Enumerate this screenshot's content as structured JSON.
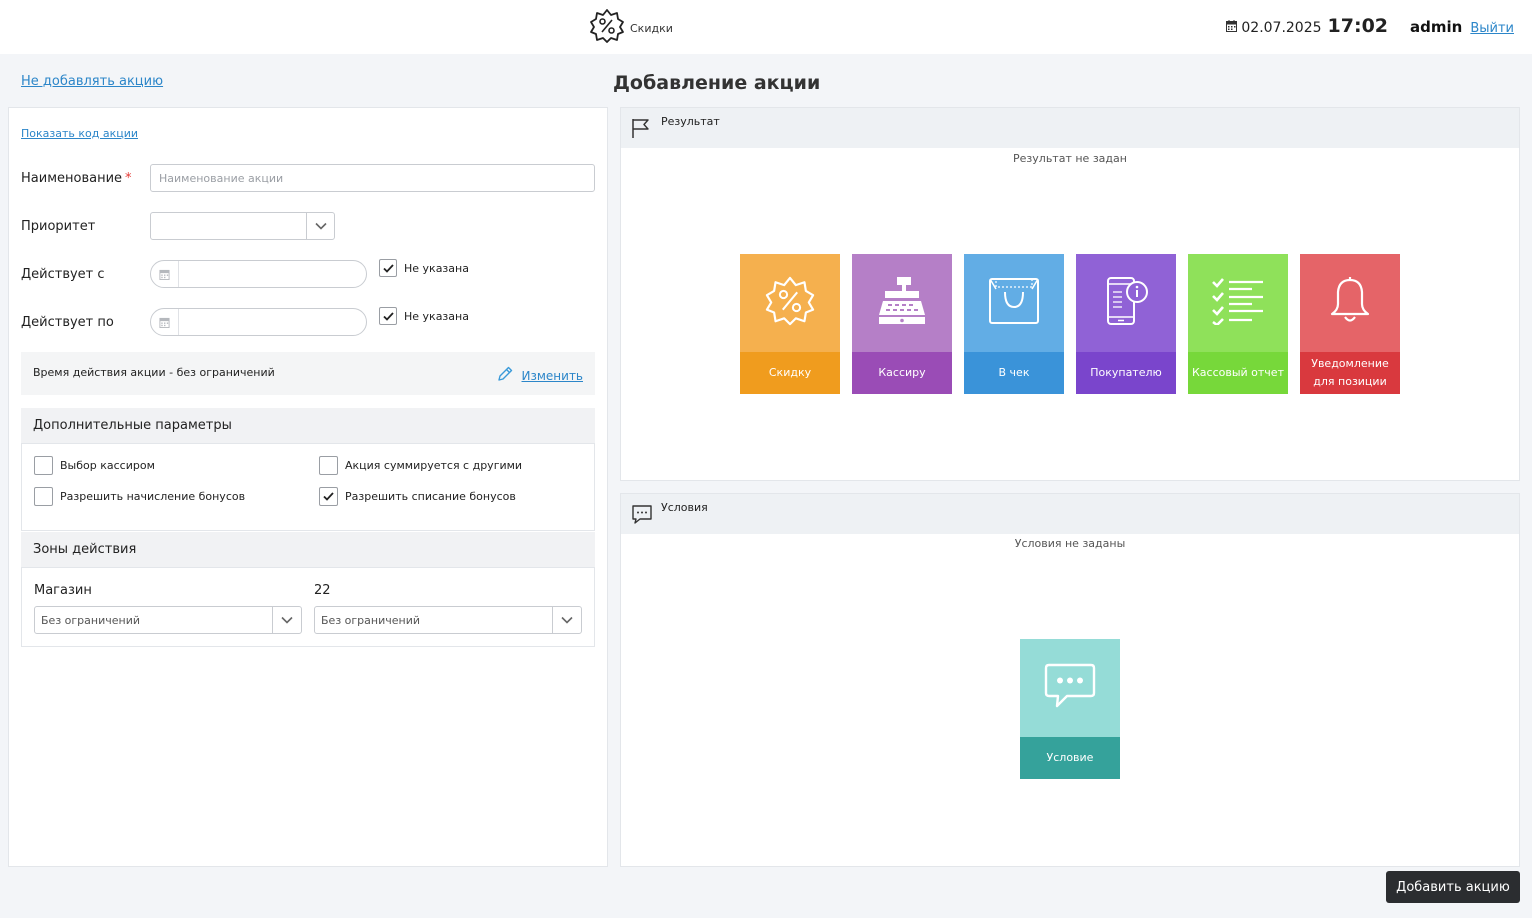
{
  "header": {
    "app_title": "Скидки",
    "date": "02.07.2025",
    "time": "17:02",
    "user": "admin",
    "logout": "Выйти"
  },
  "left": {
    "back_link": "Не добавлять акцию",
    "show_code": "Показать код акции",
    "name_label": "Наименование",
    "required_mark": "*",
    "name_placeholder": "Наименование акции",
    "priority_label": "Приоритет",
    "priority_value": "",
    "from_label": "Действует с",
    "to_label": "Действует по",
    "not_set_label": "Не указана",
    "from_not_set_checked": true,
    "to_not_set_checked": true,
    "time_text": "Время действия акции - без ограничений",
    "change_link": "Изменить",
    "extra_title": "Дополнительные параметры",
    "options": [
      {
        "label": "Выбор кассиром",
        "checked": false
      },
      {
        "label": "Акция суммируется с другими",
        "checked": false
      },
      {
        "label": "Разрешить начисление бонусов",
        "checked": false
      },
      {
        "label": "Разрешить списание бонусов",
        "checked": true
      }
    ],
    "zones_title": "Зоны действия",
    "zones": [
      {
        "label": "Магазин",
        "value": "Без ограничений"
      },
      {
        "label": "22",
        "value": "Без ограничений"
      }
    ]
  },
  "right": {
    "page_title": "Добавление акции",
    "result_title": "Результат",
    "result_empty": "Результат не задан",
    "result_tiles": [
      {
        "label": "Скидку",
        "top_color": "#f5b04e",
        "bottom_color": "#f09c1e",
        "icon": "discount-icon"
      },
      {
        "label": "Кассиру",
        "top_color": "#b57fc7",
        "bottom_color": "#9a4cb6",
        "icon": "cash-register-icon"
      },
      {
        "label": "В чек",
        "top_color": "#62ade5",
        "bottom_color": "#3a93d9",
        "icon": "shopping-bag-icon"
      },
      {
        "label": "Покупателю",
        "top_color": "#9062d6",
        "bottom_color": "#7a45cc",
        "icon": "phone-info-icon"
      },
      {
        "label": "Кассовый отчет",
        "top_color": "#8fe15a",
        "bottom_color": "#77d83a",
        "icon": "checklist-icon"
      },
      {
        "label": "Уведомление для позиции",
        "top_color": "#e56468",
        "bottom_color": "#d9393e",
        "icon": "bell-icon"
      }
    ],
    "conditions_title": "Условия",
    "conditions_empty": "Условия не заданы",
    "condition_tile": {
      "label": "Условие",
      "top_color": "#95dcd7",
      "bottom_color": "#35a29b",
      "icon": "chat-bubble-icon"
    },
    "submit": "Добавить акцию"
  }
}
